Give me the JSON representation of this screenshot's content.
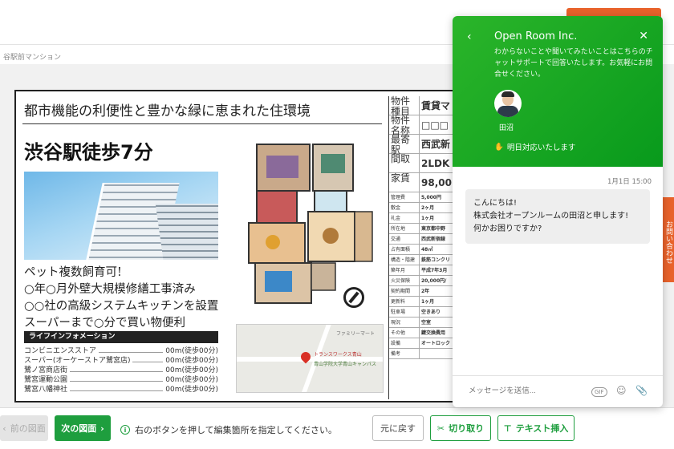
{
  "breadcrumb": "谷駅前マンション",
  "flyer": {
    "headline": "都市機能の利便性と豊かな緑に恵まれた住環境",
    "title": "渋谷駅徒歩7分",
    "features": [
      "ペット複数飼育可!",
      "○年○月外壁大規模修繕工事済み",
      "○○社の高級システムキッチンを設置",
      "スーパーまで○分で買い物便利"
    ],
    "life_info_heading": "ライフインフォメーション",
    "life_info": [
      {
        "name": "コンビニエンスストア",
        "dist": "00m(徒歩00分)"
      },
      {
        "name": "スーパー(オーケーストア鷺宮店)",
        "dist": "00m(徒歩00分)"
      },
      {
        "name": "鷺ノ宮商店街",
        "dist": "00m(徒歩00分)"
      },
      {
        "name": "鷺宮運動公園",
        "dist": "00m(徒歩00分)"
      },
      {
        "name": "鷺宮八幡神社",
        "dist": "00m(徒歩00分)"
      }
    ],
    "map_labels": [
      "トランスワークス青山",
      "青山学院大学青山キャンパス",
      "ファミリーマート"
    ],
    "spec": [
      {
        "k": "物件種目",
        "v": "賃貸マ",
        "tall": true
      },
      {
        "k": "物件名称",
        "v": "□□□",
        "tall": true
      },
      {
        "k": "最寄駅",
        "v": "西武新",
        "tall": true
      },
      {
        "k": "間取",
        "v": "2LDK",
        "tall": true
      },
      {
        "k": "家賃",
        "v": "98,00",
        "tall": true
      },
      {
        "k": "管理費",
        "v": "5,000円",
        "tall": false
      },
      {
        "k": "敷金",
        "v": "2ヶ月",
        "tall": false
      },
      {
        "k": "礼金",
        "v": "1ヶ月",
        "tall": false
      },
      {
        "k": "所在地",
        "v": "東京都中野",
        "tall": false
      },
      {
        "k": "交通",
        "v": "西武新宿線",
        "tall": false
      },
      {
        "k": "占有面積",
        "v": "48㎡",
        "tall": false
      },
      {
        "k": "構造・階建",
        "v": "鉄筋コンクリ",
        "tall": false
      },
      {
        "k": "築年月",
        "v": "平成7年3月",
        "tall": false
      },
      {
        "k": "火災保険",
        "v": "20,000円/",
        "tall": false
      },
      {
        "k": "契約期間",
        "v": "2年",
        "tall": false
      },
      {
        "k": "更新料",
        "v": "1ヶ月",
        "tall": false
      },
      {
        "k": "駐車場",
        "v": "空きあり",
        "tall": false
      },
      {
        "k": "現況",
        "v": "空室",
        "tall": false
      },
      {
        "k": "その他",
        "v": "鍵交換費用",
        "tall": false
      },
      {
        "k": "設備",
        "v": "オートロック",
        "tall": false
      },
      {
        "k": "備考",
        "v": "",
        "tall": false
      }
    ]
  },
  "toolbar": {
    "prev_label": "前の図面",
    "next_label": "次の図面",
    "hint": "右のボタンを押して編集箇所を指定してください。",
    "undo_label": "元に戻す",
    "cut_label": "切り取り",
    "text_label": "テキスト挿入"
  },
  "side_tab_label": "お問い合わせ",
  "chat": {
    "title": "Open Room Inc.",
    "description": "わからないことや聞いてみたいことはこちらのチャットサポートで回答いたします。お気軽にお問合せください。",
    "agent_name": "田沼",
    "reply_time": "明日対応いたします",
    "message_time": "1月1日 15:00",
    "message_lines": [
      "こんにちは!",
      "株式会社オープンルームの田沼と申します!",
      "何かお困りですか?"
    ],
    "input_placeholder": "メッセージを送信...",
    "gif_label": "GIF"
  },
  "colors": {
    "accent_green": "#1e9e3e",
    "accent_orange": "#e8622b"
  }
}
